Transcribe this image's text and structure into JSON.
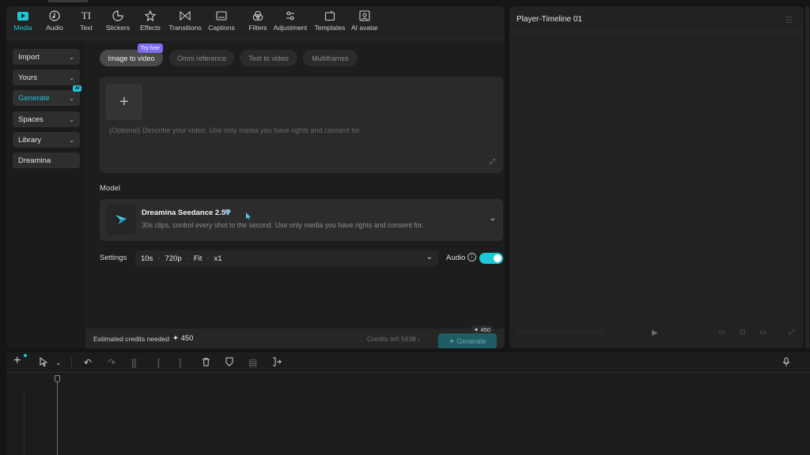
{
  "toolbar": {
    "tabs": [
      {
        "label": "Media",
        "icon": "media-icon"
      },
      {
        "label": "Audio",
        "icon": "audio-icon"
      },
      {
        "label": "Text",
        "icon": "text-icon"
      },
      {
        "label": "Stickers",
        "icon": "stickers-icon"
      },
      {
        "label": "Effects",
        "icon": "effects-icon"
      },
      {
        "label": "Transitions",
        "icon": "transitions-icon"
      },
      {
        "label": "Captions",
        "icon": "captions-icon"
      },
      {
        "label": "Filters",
        "icon": "filters-icon"
      },
      {
        "label": "Adjustment",
        "icon": "adjustment-icon"
      },
      {
        "label": "Templates",
        "icon": "templates-icon"
      },
      {
        "label": "AI avatar",
        "icon": "ai-avatar-icon"
      }
    ],
    "active": "Media",
    "accent": "#1fc6d8"
  },
  "sidebar": {
    "items": [
      {
        "label": "Import",
        "chevron": true
      },
      {
        "label": "Yours",
        "chevron": true
      },
      {
        "label": "Generate",
        "chevron": true,
        "badge": "AI"
      },
      {
        "label": "Spaces",
        "chevron": true
      },
      {
        "label": "Library",
        "chevron": true
      },
      {
        "label": "Dreamina",
        "chevron": false
      }
    ]
  },
  "modes": {
    "tabs": [
      "Image to video",
      "Omni reference",
      "Text to video",
      "Multiframes"
    ],
    "active": "Image to video",
    "promo_badge": "Try free"
  },
  "prompt": {
    "placeholder": "(Optional) Describe your video. Use only media you have rights and consent for.",
    "add_symbol": "+"
  },
  "model": {
    "section_label": "Model",
    "name": "Dreamina Seedance 2.5",
    "description": "30s clips, control every shot to the second. Use only media you have rights and consent for."
  },
  "settings": {
    "label": "Settings",
    "duration": "10s",
    "resolution": "720p",
    "fit": "Fit",
    "count": "x1",
    "audio_label": "Audio",
    "audio_on": true
  },
  "footer": {
    "estimate_label": "Estimated credits needed",
    "estimate_value": "✦ 450",
    "credits_left": "Credits left 5638  ›",
    "generate_label": "✦ Generate",
    "generate_badge": "✦ 450"
  },
  "player": {
    "title": "Player-Timeline 01"
  }
}
